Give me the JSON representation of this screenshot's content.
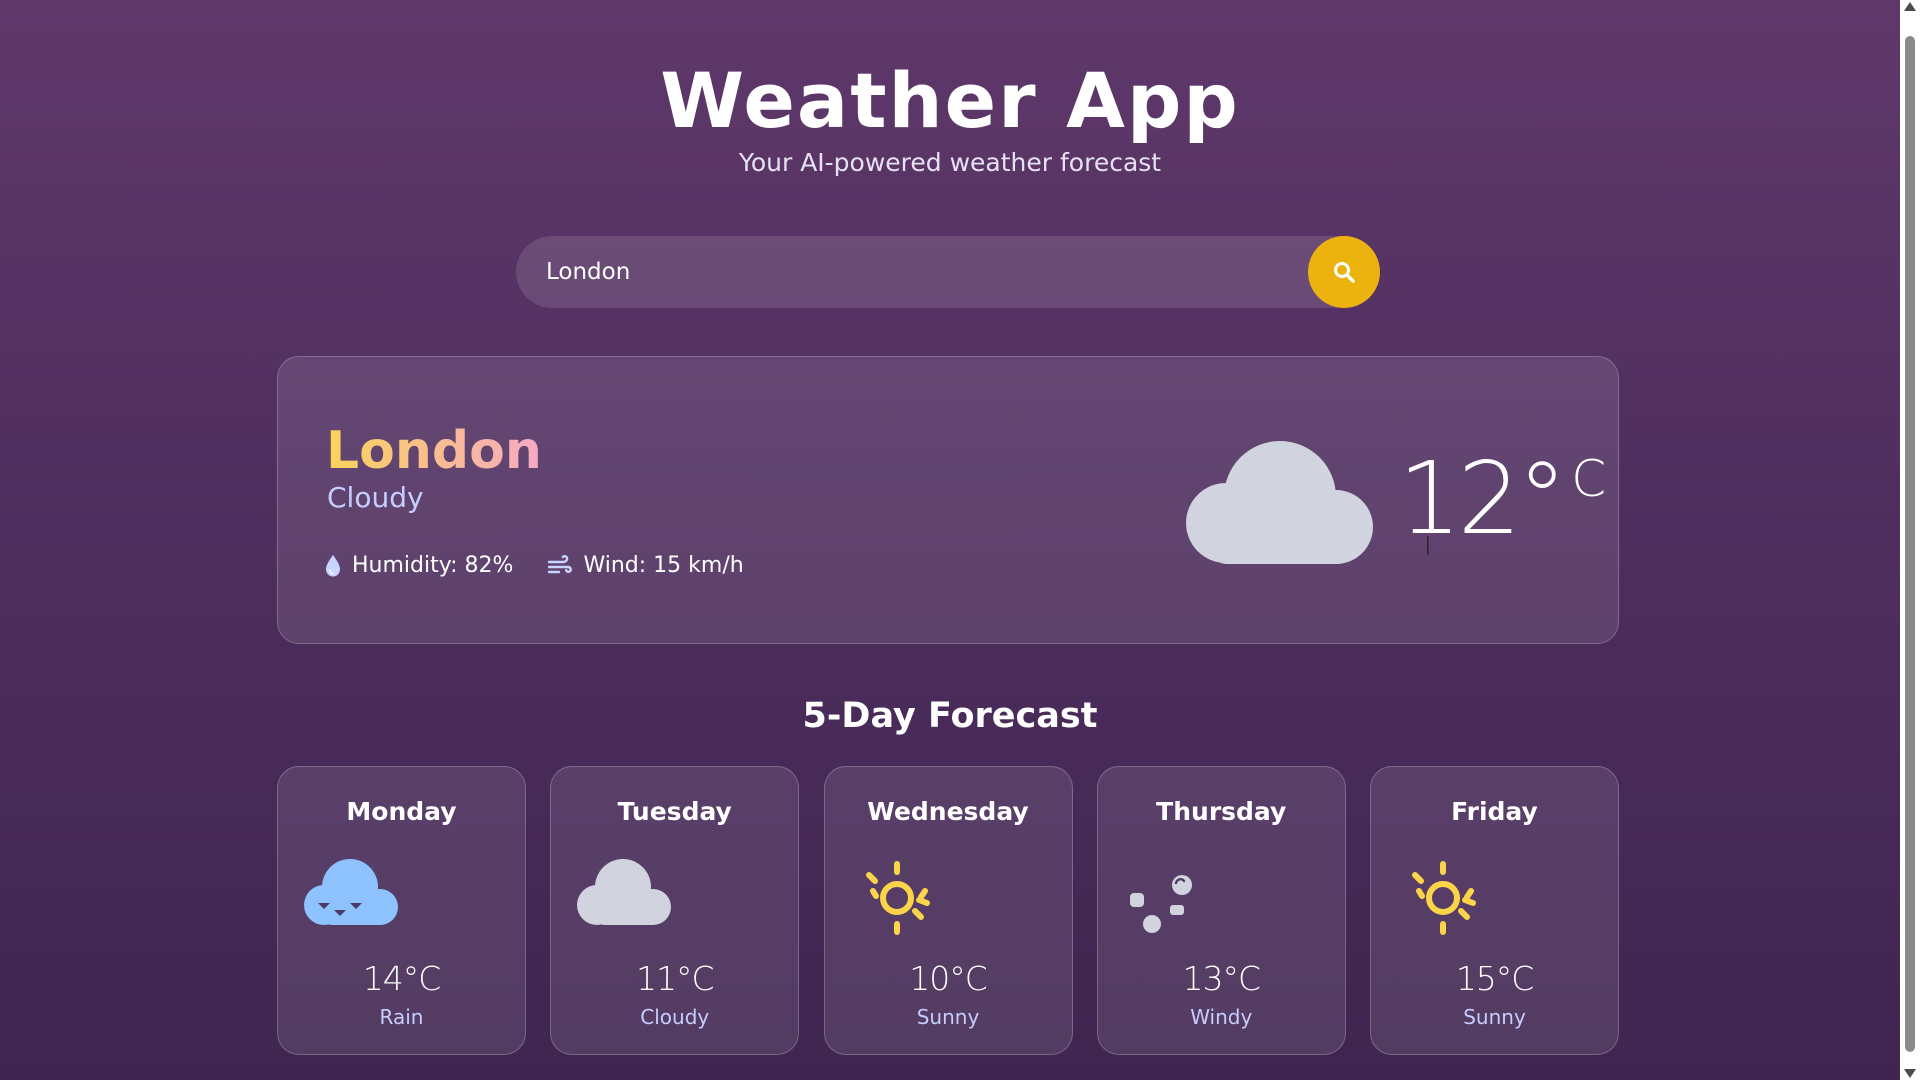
{
  "header": {
    "title": "Weather App",
    "subtitle": "Your AI-powered weather forecast"
  },
  "search": {
    "value": "London",
    "button_icon": "search-icon"
  },
  "current": {
    "city": "London",
    "condition": "Cloudy",
    "humidity_label": "Humidity: 82%",
    "wind_label": "Wind: 15 km/h",
    "temperature": "12",
    "unit_degree": "°",
    "unit_c": "C",
    "icon": "cloud-icon"
  },
  "forecast": {
    "title": "5-Day Forecast",
    "days": [
      {
        "day": "Monday",
        "temp": "14°C",
        "condition": "Rain",
        "icon": "rain-cloud-icon"
      },
      {
        "day": "Tuesday",
        "temp": "11°C",
        "condition": "Cloudy",
        "icon": "cloud-icon"
      },
      {
        "day": "Wednesday",
        "temp": "10°C",
        "condition": "Sunny",
        "icon": "sun-icon"
      },
      {
        "day": "Thursday",
        "temp": "13°C",
        "condition": "Windy",
        "icon": "wind-icon"
      },
      {
        "day": "Friday",
        "temp": "15°C",
        "condition": "Sunny",
        "icon": "sun-icon"
      }
    ]
  },
  "colors": {
    "accent": "#ecb30f",
    "city_gradient_start": "#fbd35b",
    "city_gradient_end": "#f6a9c4",
    "condition_text": "#c7cdff",
    "cloud": "#d1d3de",
    "rain_cloud": "#8ec3ff",
    "sun": "#fcd44a"
  }
}
